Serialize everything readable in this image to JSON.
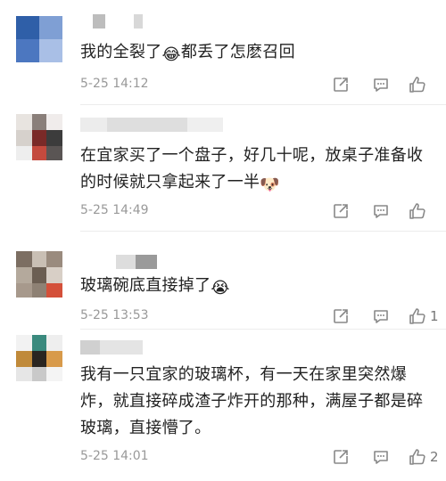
{
  "comments": [
    {
      "text": "我的全裂了",
      "emoji": "😂",
      "text_after": "都丢了怎麽召回",
      "time": "5-25 14:12",
      "likes": ""
    },
    {
      "text": "在宜家买了一个盘子，好几十呢，放桌子准备收的时候就只拿起来了一半",
      "emoji": "🐶",
      "text_after": "",
      "time": "5-25 14:49",
      "likes": ""
    },
    {
      "text": "玻璃碗底直接掉了",
      "emoji": "😭",
      "text_after": "",
      "time": "5-25 13:53",
      "likes": "1"
    },
    {
      "text": "我有一只宜家的玻璃杯，有一天在家里突然爆炸，就直接碎成渣子炸开的那种，满屋子都是碎玻璃，直接懵了。",
      "emoji": "",
      "text_after": "",
      "time": "5-25 14:01",
      "likes": "2"
    }
  ],
  "icons": {
    "share": "share-icon",
    "reply": "reply-icon",
    "like": "thumbs-up-icon"
  },
  "colors": {
    "text": "#222222",
    "meta": "#999999",
    "icon": "#888888"
  }
}
